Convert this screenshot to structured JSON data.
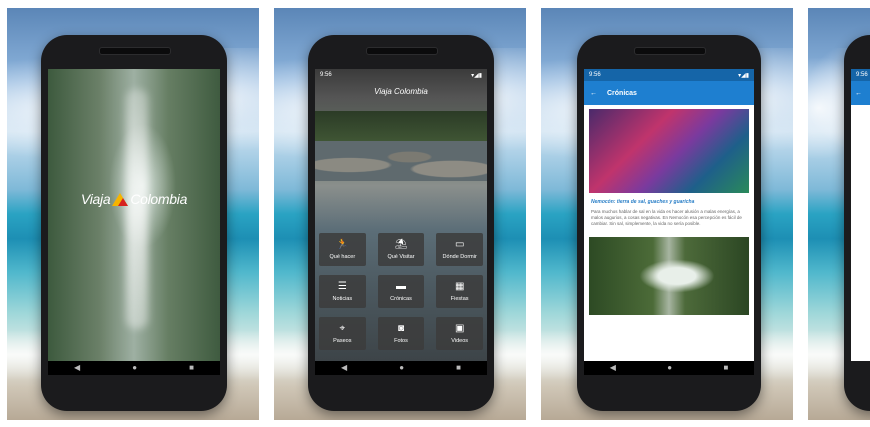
{
  "splash": {
    "logo_left": "Viaja",
    "logo_right": "Colombia"
  },
  "home": {
    "status_time": "9:56",
    "logo": "Viaja Colombia",
    "tiles": [
      {
        "label": "Qué hacer",
        "icon": "runner-icon"
      },
      {
        "label": "Qué Visitar",
        "icon": "umbrella-icon"
      },
      {
        "label": "Dónde Dormir",
        "icon": "bed-icon"
      },
      {
        "label": "Noticias",
        "icon": "news-icon"
      },
      {
        "label": "Crónicas",
        "icon": "chat-icon"
      },
      {
        "label": "Fiestas",
        "icon": "calendar-icon"
      },
      {
        "label": "Paseos",
        "icon": "location-pin-icon"
      },
      {
        "label": "Fotos",
        "icon": "camera-icon"
      },
      {
        "label": "Videos",
        "icon": "video-icon"
      }
    ]
  },
  "cronicas": {
    "status_time": "9:56",
    "title": "Crónicas",
    "article_title": "Nemocón: tierra de sal, guaches y guaricha",
    "article_text": "Para muchos hablar de sal en la vida es hacer alusión a malas energías, a malos augurios, a cosas negativas. En Nemocón esa percepción es fácil de cambiar. Sin sal, simplemente, la vida no sería posible."
  },
  "card4": {
    "status_time": "9:56"
  }
}
